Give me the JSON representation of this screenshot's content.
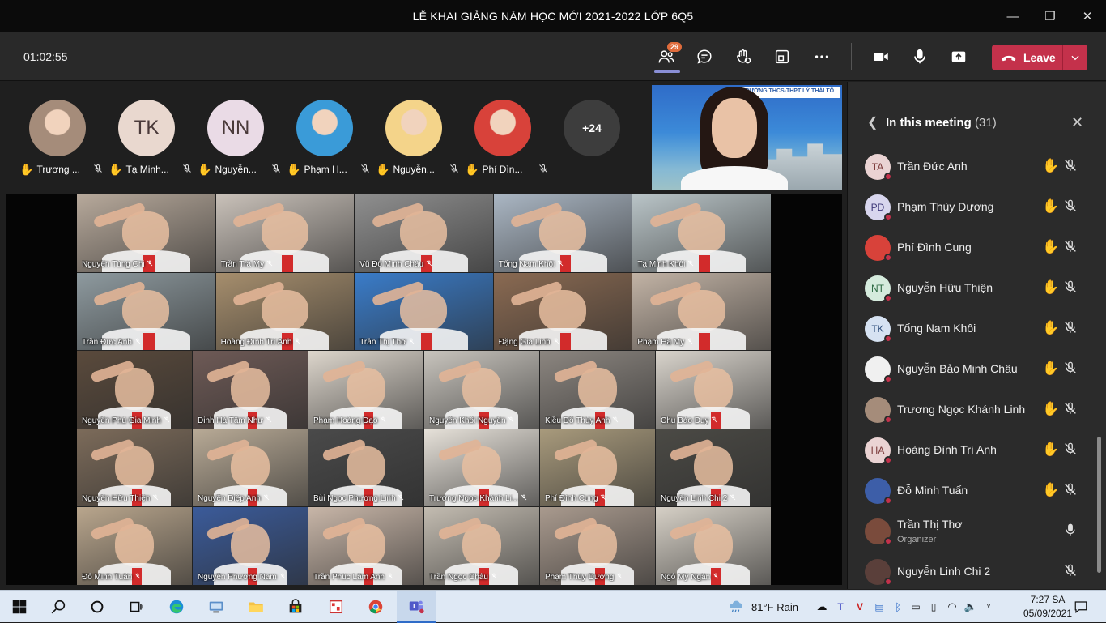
{
  "window": {
    "title": "LỄ KHAI GIẢNG NĂM HỌC MỚI 2021-2022 LỚP 6Q5",
    "minimize": "—",
    "maximize": "❐",
    "close": "✕"
  },
  "toolbar": {
    "timer": "01:02:55",
    "participants_badge": "29",
    "leave_label": "Leave",
    "icons": [
      "people-icon",
      "chat-icon",
      "raise-hand-icon",
      "breakout-icon",
      "more-icon",
      "camera-icon",
      "mic-icon",
      "share-icon",
      "phone-icon",
      "chevron-down-icon"
    ]
  },
  "strip": {
    "avatars": [
      {
        "initials": "",
        "label": "Trương ...",
        "kind": "photo",
        "color": "#a58c7a"
      },
      {
        "initials": "TK",
        "label": "Tạ Minh...",
        "kind": "initials",
        "color": "#e9d8cf"
      },
      {
        "initials": "NN",
        "label": "Nguyễn...",
        "kind": "initials",
        "color": "#eadbe6"
      },
      {
        "initials": "",
        "label": "Phạm H...",
        "kind": "photo",
        "color": "#3a9bd8"
      },
      {
        "initials": "",
        "label": "Nguyễn...",
        "kind": "photo",
        "color": "#f4d48a"
      },
      {
        "initials": "",
        "label": "Phí Đìn...",
        "kind": "photo",
        "color": "#d8423a"
      }
    ],
    "overflow": "+24"
  },
  "spotlight": {
    "banner": "TRƯỜNG THCS-THPT LÝ THÁI TỔ"
  },
  "grid": {
    "rows": [
      [
        {
          "name": "Nguyễn Tùng Chi",
          "bg": "#b7a99b"
        },
        {
          "name": "Trần Trà My",
          "bg": "#c9c1b9"
        },
        {
          "name": "Vũ Đỗ Minh Châu",
          "bg": "#8f8f8f"
        },
        {
          "name": "Tống Nam Khôi",
          "bg": "#aab6c3"
        },
        {
          "name": "Tạ Minh Khôi",
          "bg": "#b9c4c7"
        }
      ],
      [
        {
          "name": "Trần Đức Anh",
          "bg": "#8e9a9f"
        },
        {
          "name": "Hoàng Đình Trí Anh",
          "bg": "#a68e6d"
        },
        {
          "name": "Trần Thị Thơ",
          "bg": "#3a7cc9"
        },
        {
          "name": "Đặng Gia Linh",
          "bg": "#8a6a52"
        },
        {
          "name": "Phạm Hà My",
          "bg": "#c2b3a5"
        }
      ],
      [
        {
          "name": "Nguyễn Phú Gia Minh",
          "bg": "#5a4a3c"
        },
        {
          "name": "Đinh Hà Tâm Như",
          "bg": "#6e5a56"
        },
        {
          "name": "Phạm Hoàng Đạo",
          "bg": "#ddd6cc"
        },
        {
          "name": "Nguyễn Khôi Nguyên",
          "bg": "#c8c4bd"
        },
        {
          "name": "Kiều Đỗ Thủy Anh",
          "bg": "#8c8680"
        },
        {
          "name": "Chu Bảo Duy",
          "bg": "#d9d4cc"
        }
      ],
      [
        {
          "name": "Nguyễn Hữu Thiện",
          "bg": "#7c6b5a"
        },
        {
          "name": "Nguyễn Diệp Anh",
          "bg": "#b8aa96"
        },
        {
          "name": "Bùi Ngọc Phương Linh",
          "bg": "#4a4a4a"
        },
        {
          "name": "Trương Ngọc Khánh Li...",
          "bg": "#e6e1d9"
        },
        {
          "name": "Phí Đình Cung",
          "bg": "#a89a7c"
        },
        {
          "name": "Nguyễn Linh Chi 2",
          "bg": "#4b4a45"
        }
      ],
      [
        {
          "name": "Đỗ Minh Tuấn",
          "bg": "#b9a68d"
        },
        {
          "name": "Nguyễn Phương Nam",
          "bg": "#3b5b9a"
        },
        {
          "name": "Trần Phúc Lâm Anh",
          "bg": "#c8b6a8"
        },
        {
          "name": "Trần Ngọc Châu",
          "bg": "#c3bcb1"
        },
        {
          "name": "Phạm Thùy Dương",
          "bg": "#a99a8e"
        },
        {
          "name": "Ngô Mỹ Ngân",
          "bg": "#d6d0c6"
        }
      ]
    ]
  },
  "panel": {
    "title": "In this meeting",
    "count": "(31)",
    "participants": [
      {
        "name": "Trần Đức Anh",
        "initials": "TA",
        "avatar_color": "#ead3d3",
        "text_color": "#7b3a3a",
        "hand": true,
        "mic": "muted"
      },
      {
        "name": "Phạm Thùy Dương",
        "initials": "PD",
        "avatar_color": "#d8d6ee",
        "text_color": "#3f3a7a",
        "hand": true,
        "mic": "muted"
      },
      {
        "name": "Phí Đình Cung",
        "initials": "",
        "avatar_color": "#d8423a",
        "text_color": "#fff",
        "hand": true,
        "mic": "muted"
      },
      {
        "name": "Nguyễn Hữu Thiện",
        "initials": "NT",
        "avatar_color": "#d5ebdd",
        "text_color": "#2f6b45",
        "hand": true,
        "mic": "muted"
      },
      {
        "name": "Tống Nam Khôi",
        "initials": "TK",
        "avatar_color": "#d6e2f2",
        "text_color": "#2f4f7c",
        "hand": true,
        "mic": "muted"
      },
      {
        "name": "Nguyễn Bảo Minh Châu",
        "initials": "",
        "avatar_color": "#f0f0f0",
        "text_color": "#333",
        "hand": true,
        "mic": "muted"
      },
      {
        "name": "Trương Ngọc Khánh Linh",
        "initials": "",
        "avatar_color": "#a58c7a",
        "text_color": "#fff",
        "hand": true,
        "mic": "muted"
      },
      {
        "name": "Hoàng Đình Trí Anh",
        "initials": "HA",
        "avatar_color": "#ead3d3",
        "text_color": "#7b3a3a",
        "hand": true,
        "mic": "muted"
      },
      {
        "name": "Đỗ Minh Tuấn",
        "initials": "",
        "avatar_color": "#3d5ea8",
        "text_color": "#fff",
        "hand": true,
        "mic": "muted"
      },
      {
        "name": "Trần Thị Thơ",
        "initials": "",
        "role": "Organizer",
        "avatar_color": "#7a4b3c",
        "text_color": "#fff",
        "hand": false,
        "mic": "on"
      },
      {
        "name": "Nguyễn Linh Chi 2",
        "initials": "",
        "avatar_color": "#5a3f3a",
        "text_color": "#fff",
        "hand": false,
        "mic": "muted"
      }
    ]
  },
  "taskbar": {
    "weather": "81°F  Rain",
    "time": "7:27 SA",
    "date": "05/09/2021",
    "apps": [
      "windows-start-icon",
      "search-icon",
      "cortana-icon",
      "task-view-icon",
      "edge-icon",
      "network-app-icon",
      "file-explorer-icon",
      "store-icon",
      "photos-app-icon",
      "chrome-icon",
      "teams-icon"
    ]
  }
}
